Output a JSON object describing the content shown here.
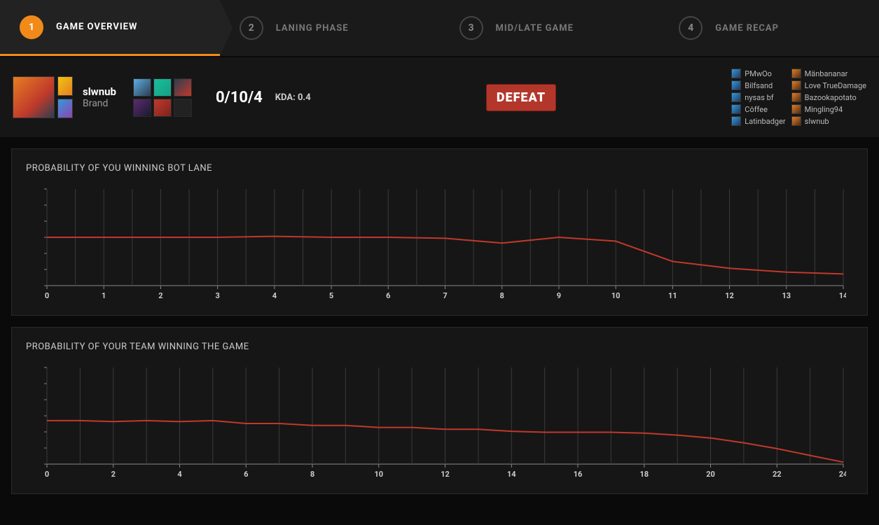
{
  "tabs": [
    {
      "num": "1",
      "label": "GAME OVERVIEW",
      "active": true
    },
    {
      "num": "2",
      "label": "LANING PHASE",
      "active": false
    },
    {
      "num": "3",
      "label": "MID/LATE GAME",
      "active": false
    },
    {
      "num": "4",
      "label": "GAME RECAP",
      "active": false
    }
  ],
  "player": {
    "name": "slwnub",
    "champion": "Brand",
    "kda": "0/10/4",
    "kda_label": "KDA: 0.4"
  },
  "result": "DEFEAT",
  "team1": [
    "PMwOo",
    "Bilfsand",
    "nysas bf",
    "Côffee",
    "Latinbadger"
  ],
  "team2": [
    "Mänbananar",
    "Love TrueDamage",
    "Bazookapotato",
    "Mingling94",
    "slwnub"
  ],
  "chart_data": [
    {
      "type": "line",
      "title": "PROBABILITY OF YOU WINNING BOT LANE",
      "xlabel": "",
      "ylabel": "",
      "ylim": [
        0,
        1
      ],
      "x": [
        0,
        1,
        2,
        3,
        4,
        5,
        6,
        7,
        8,
        9,
        10,
        11,
        12,
        13,
        14
      ],
      "values": [
        0.5,
        0.5,
        0.5,
        0.5,
        0.51,
        0.5,
        0.5,
        0.49,
        0.44,
        0.5,
        0.46,
        0.25,
        0.18,
        0.14,
        0.12
      ]
    },
    {
      "type": "line",
      "title": "PROBABILITY OF YOUR TEAM WINNING THE GAME",
      "xlabel": "",
      "ylabel": "",
      "ylim": [
        0,
        1
      ],
      "x": [
        0,
        2,
        4,
        6,
        8,
        10,
        12,
        14,
        16,
        18,
        20,
        22,
        24
      ],
      "values_full_x": [
        0,
        1,
        2,
        3,
        4,
        5,
        6,
        7,
        8,
        9,
        10,
        11,
        12,
        13,
        14,
        15,
        16,
        17,
        18,
        19,
        20,
        21,
        22,
        23,
        24
      ],
      "values": [
        0.45,
        0.45,
        0.44,
        0.45,
        0.44,
        0.45,
        0.42,
        0.42,
        0.4,
        0.4,
        0.38,
        0.38,
        0.36,
        0.36,
        0.34,
        0.33,
        0.33,
        0.33,
        0.32,
        0.3,
        0.27,
        0.22,
        0.16,
        0.09,
        0.02
      ]
    }
  ]
}
